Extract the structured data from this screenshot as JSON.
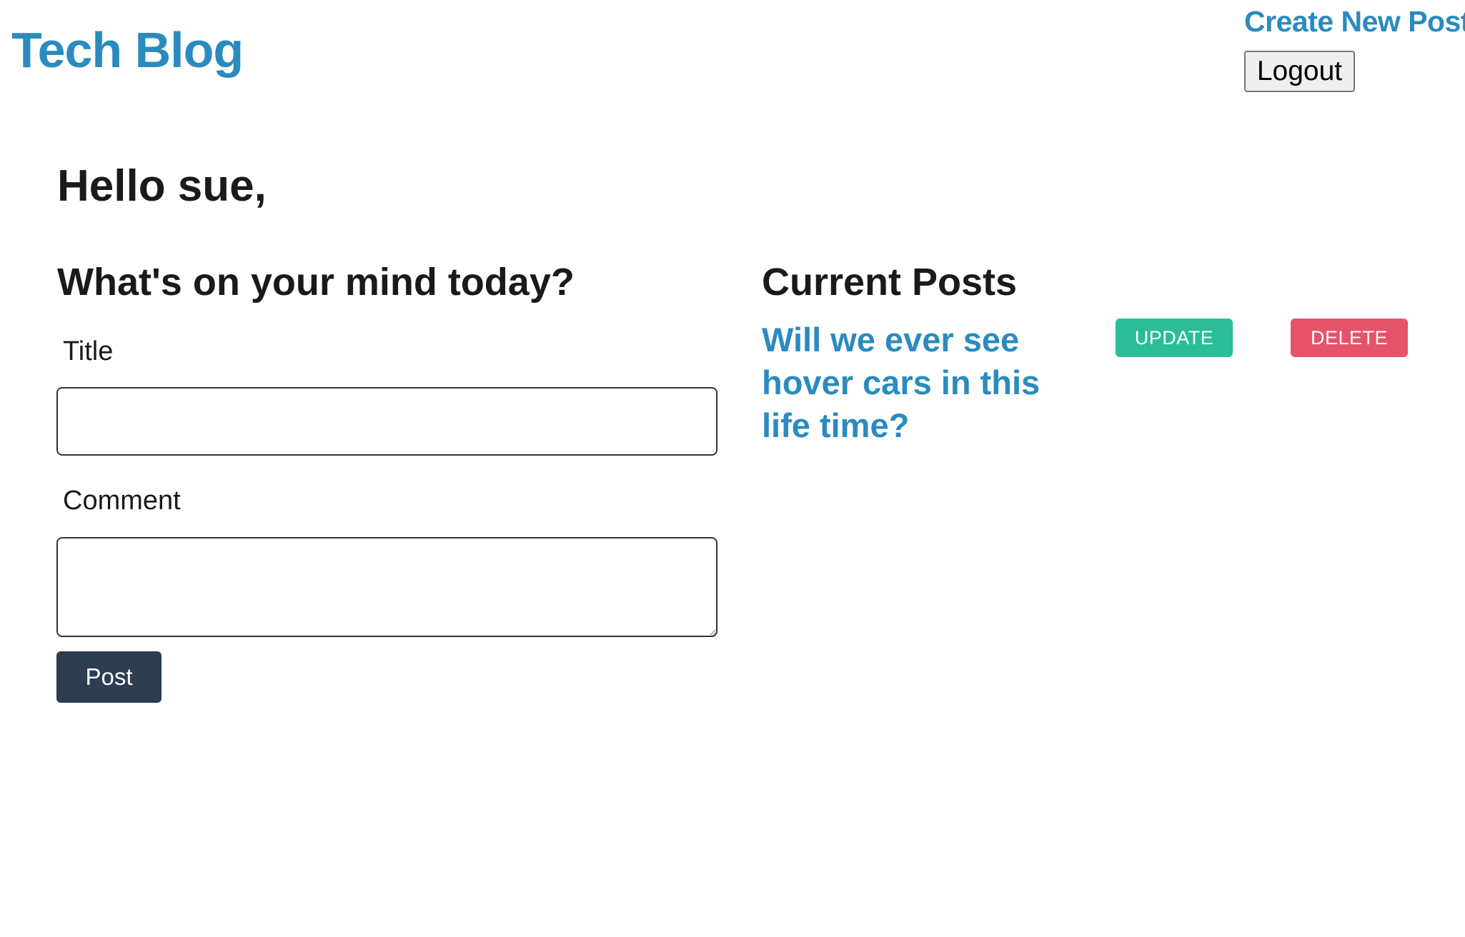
{
  "header": {
    "site_title": "Tech Blog",
    "create_post_link": "Create New Post",
    "logout_label": "Logout"
  },
  "dashboard": {
    "greeting": "Hello sue,"
  },
  "new_post_form": {
    "heading": "What's on your mind today?",
    "title_label": "Title",
    "title_value": "",
    "comment_label": "Comment",
    "comment_value": "",
    "submit_label": "Post"
  },
  "current_posts": {
    "heading": "Current Posts",
    "posts": [
      {
        "title": "Will we ever see hover cars in this life time?",
        "update_label": "UPDATE",
        "delete_label": "DELETE"
      }
    ]
  },
  "colors": {
    "brand": "#2a8bbe",
    "update": "#2bbd96",
    "delete": "#e5536a",
    "post_button": "#2c3e50"
  }
}
